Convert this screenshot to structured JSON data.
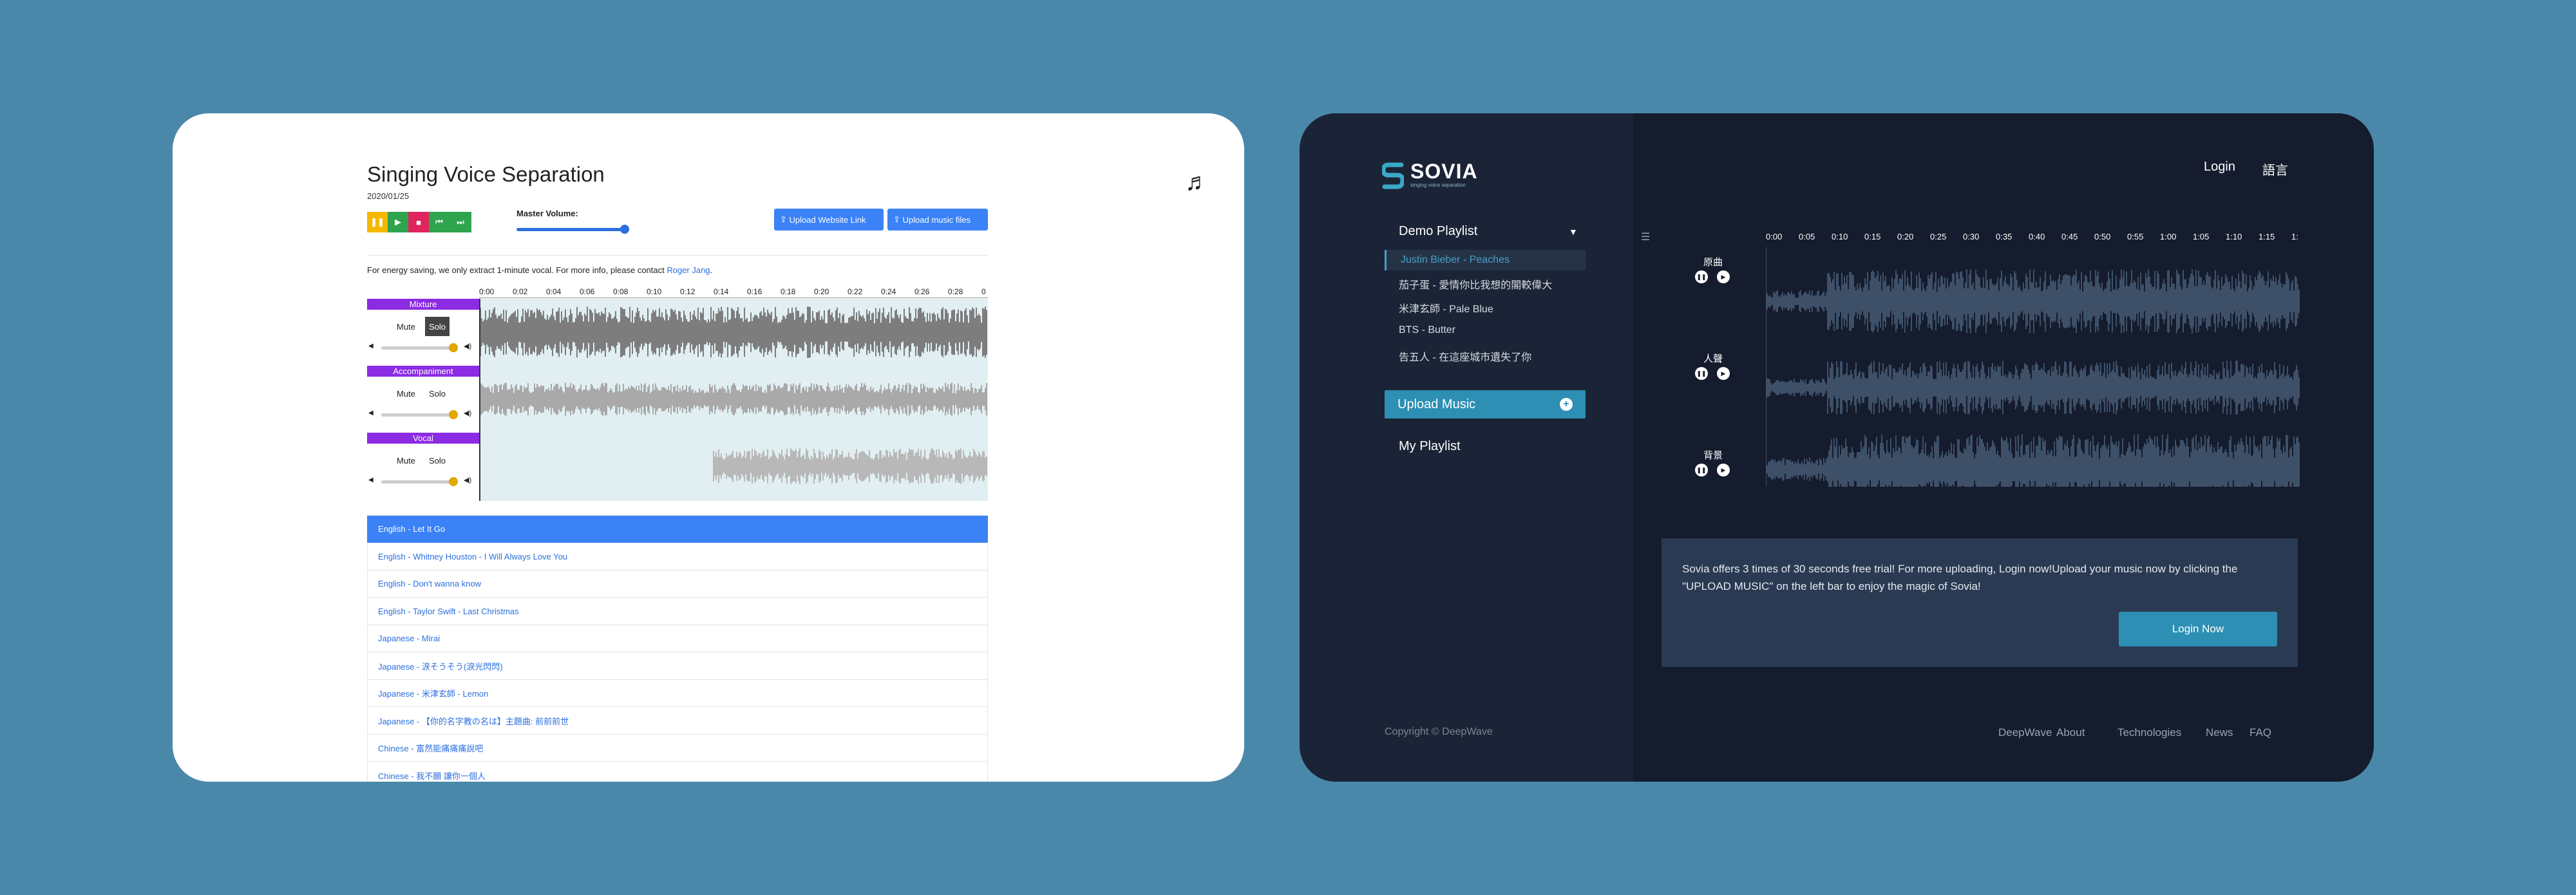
{
  "left": {
    "title": "Singing Voice Separation",
    "date": "2020/01/25",
    "controls": {
      "pause_icon": "pause-icon",
      "play_icon": "play-icon",
      "stop_icon": "stop-icon",
      "rewind_icon": "skip-back-icon",
      "forward_icon": "skip-forward-icon",
      "pause_color": "#f5b800",
      "play_color": "#2ea44f",
      "stop_color": "#e0245e",
      "rewind_color": "#2ea44f",
      "forward_color": "#2ea44f"
    },
    "master_volume_label": "Master Volume:",
    "master_volume": 0.95,
    "upload_link_label": "Upload Website Link",
    "upload_files_label": "Upload music files",
    "info_prefix": "For energy saving, we only extract 1-minute vocal. For more info, please contact ",
    "info_link": "Roger Jang",
    "info_suffix": ".",
    "ticks": [
      "0:00",
      "0:02",
      "0:04",
      "0:06",
      "0:08",
      "0:10",
      "0:12",
      "0:14",
      "0:16",
      "0:18",
      "0:20",
      "0:22",
      "0:24",
      "0:26",
      "0:28",
      "0"
    ],
    "tracks": [
      {
        "name": "Mixture",
        "mute": "Mute",
        "solo": "Solo",
        "solo_active": true,
        "volume": 0.95
      },
      {
        "name": "Accompaniment",
        "mute": "Mute",
        "solo": "Solo",
        "solo_active": false,
        "volume": 0.95
      },
      {
        "name": "Vocal",
        "mute": "Mute",
        "solo": "Solo",
        "solo_active": false,
        "volume": 0.95
      }
    ],
    "songs": [
      "English - Let It Go",
      "English - Whitney Houston - I Will Always Love You",
      "English - Don't wanna know",
      "English - Taylor Swift - Last Christmas",
      "Japanese - Mirai",
      "Japanese - 涙そうそう(淚光閃閃)",
      "Japanese - 米津玄師 - Lemon",
      "Japanese - 【你的名字教の名は】主題曲: 前前前世",
      "Chinese - 富然能痛痛痛說吧",
      "Chinese - 我不願 讓你一個人"
    ],
    "active_song": 0
  },
  "right": {
    "logo": "SOVIA",
    "logo_sub": "singing voice separation",
    "playlist_title": "Demo Playlist",
    "playlist": [
      "Justin Bieber - Peaches",
      "茄子蛋 - 愛情你比我想的閣較偉大",
      "米津玄師 - Pale Blue",
      "BTS - Butter",
      "告五人 - 在這座城市遺失了你"
    ],
    "active_item": 0,
    "upload_music": "Upload Music",
    "my_playlist": "My Playlist",
    "copyright": "Copyright © DeepWave",
    "nav": {
      "login": "Login",
      "language": "語言"
    },
    "track_labels": [
      "原曲",
      "人聲",
      "背景"
    ],
    "ticks": [
      "0:00",
      "0:05",
      "0:10",
      "0:15",
      "0:20",
      "0:25",
      "0:30",
      "0:35",
      "0:40",
      "0:45",
      "0:50",
      "0:55",
      "1:00",
      "1:05",
      "1:10",
      "1:15",
      "1:"
    ],
    "info": "Sovia offers 3 times of 30 seconds free trial! For more uploading, Login now!Upload your music now by clicking the \"UPLOAD MUSIC\" on the left bar to enjoy the magic of Sovia!",
    "login_now": "Login Now",
    "footer": [
      "DeepWave",
      "About",
      "Technologies",
      "News",
      "FAQ"
    ]
  }
}
